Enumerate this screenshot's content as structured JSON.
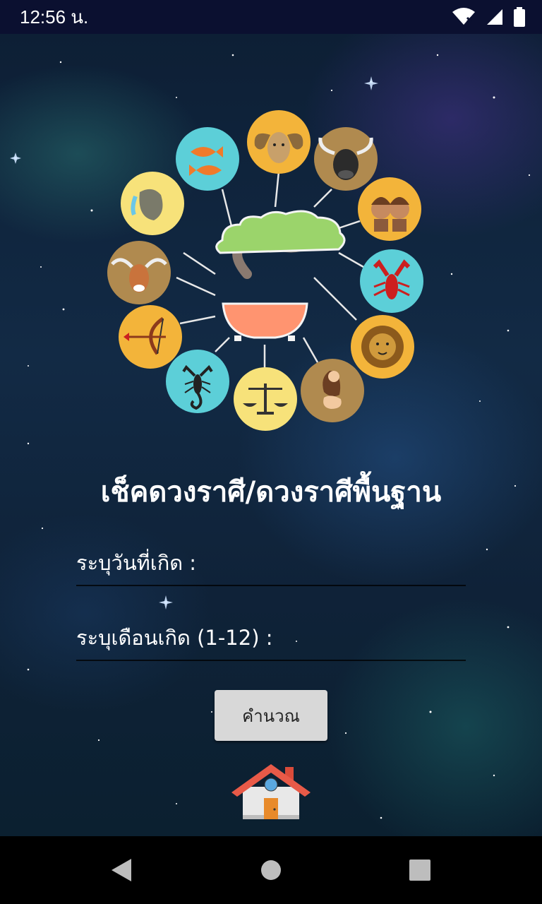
{
  "status_bar": {
    "time": "12:56 น."
  },
  "screen": {
    "title": "เช็คดวงราศี/ดวงราศีพื้นฐาน",
    "day_field": {
      "label": "ระบุวันที่เกิด :",
      "value": ""
    },
    "month_field": {
      "label": "ระบุเดือนเกิด (1-12) :",
      "value": ""
    },
    "calculate_button": "คำนวณ"
  },
  "zodiac_signs": [
    "aries",
    "taurus",
    "gemini",
    "cancer",
    "leo",
    "virgo",
    "libra",
    "scorpio",
    "sagittarius",
    "capricorn",
    "aquarius",
    "pisces"
  ],
  "colors": {
    "status_bar_bg": "#0b1030",
    "title_text": "#ffffff",
    "button_bg": "#d8d8d8",
    "zodiac_yellow": "#f3b43a",
    "zodiac_cyan": "#5ccfd8",
    "zodiac_brown": "#b08a4f",
    "tree_green": "#9bd46b",
    "pot_salmon": "#ff9470"
  }
}
